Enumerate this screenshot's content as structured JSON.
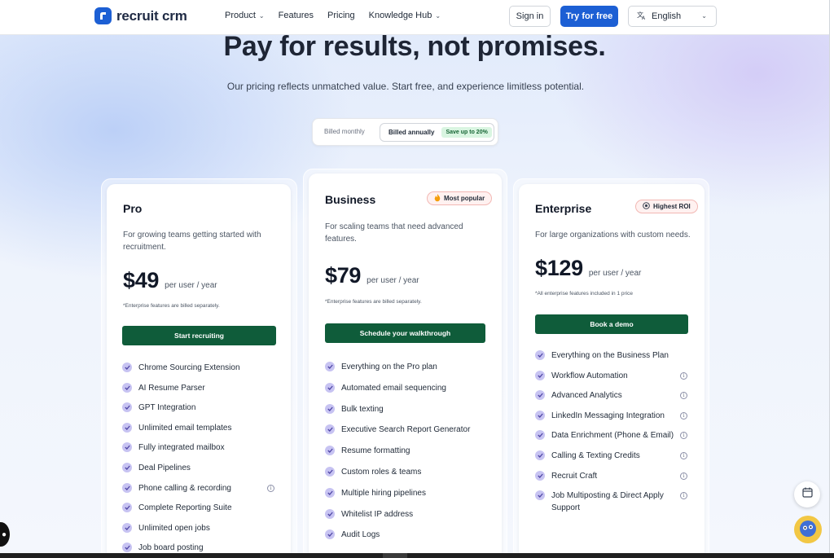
{
  "header": {
    "logo_text": "recruit crm",
    "nav": [
      {
        "label": "Product",
        "has_dropdown": true
      },
      {
        "label": "Features",
        "has_dropdown": false
      },
      {
        "label": "Pricing",
        "has_dropdown": false
      },
      {
        "label": "Knowledge Hub",
        "has_dropdown": true
      }
    ],
    "sign_in": "Sign in",
    "try_free": "Try for free",
    "language": "English"
  },
  "hero": {
    "title": "Pay for results, not promises.",
    "subtitle": "Our pricing reflects unmatched value. Start free, and experience limitless potential."
  },
  "billing": {
    "monthly": "Billed monthly",
    "annually": "Billed annually",
    "save": "Save up to 20%",
    "selected": "annually"
  },
  "plans": [
    {
      "name": "Pro",
      "description": "For growing teams getting started with recruitment.",
      "price": "$49",
      "per": "per user / year",
      "note": "*Enterprise features are billed separately.",
      "cta": "Start recruiting",
      "features": [
        {
          "label": "Chrome Sourcing Extension",
          "info": false
        },
        {
          "label": "AI Resume Parser",
          "info": false
        },
        {
          "label": "GPT Integration",
          "info": false
        },
        {
          "label": "Unlimited email templates",
          "info": false
        },
        {
          "label": "Fully integrated mailbox",
          "info": false
        },
        {
          "label": "Deal Pipelines",
          "info": false
        },
        {
          "label": "Phone calling & recording",
          "info": true
        },
        {
          "label": "Complete Reporting Suite",
          "info": false
        },
        {
          "label": "Unlimited open jobs",
          "info": false
        },
        {
          "label": "Job board posting",
          "info": false
        }
      ]
    },
    {
      "name": "Business",
      "badge": "Most popular",
      "description": "For scaling teams that need advanced features.",
      "price": "$79",
      "per": "per user / year",
      "note": "*Enterprise features are billed separately.",
      "cta": "Schedule your walkthrough",
      "features": [
        {
          "label": "Everything on the Pro plan",
          "info": false
        },
        {
          "label": "Automated email sequencing",
          "info": false
        },
        {
          "label": "Bulk texting",
          "info": false
        },
        {
          "label": "Executive Search Report Generator",
          "info": false
        },
        {
          "label": "Resume formatting",
          "info": false
        },
        {
          "label": "Custom roles & teams",
          "info": false
        },
        {
          "label": "Multiple hiring pipelines",
          "info": false
        },
        {
          "label": "Whitelist IP address",
          "info": false
        },
        {
          "label": "Audit Logs",
          "info": false
        }
      ]
    },
    {
      "name": "Enterprise",
      "badge": "Highest ROI",
      "description": "For large organizations with custom needs.",
      "price": "$129",
      "per": "per user / year",
      "note": "*All enterprise features included in 1 price",
      "cta": "Book a demo",
      "features": [
        {
          "label": "Everything on the Business Plan",
          "info": false
        },
        {
          "label": "Workflow Automation",
          "info": true
        },
        {
          "label": "Advanced Analytics",
          "info": true
        },
        {
          "label": "LinkedIn Messaging Integration",
          "info": true
        },
        {
          "label": "Data Enrichment (Phone & Email)",
          "info": true
        },
        {
          "label": "Calling & Texting Credits",
          "info": true
        },
        {
          "label": "Recruit Craft",
          "info": true
        },
        {
          "label": "Job Multiposting & Direct Apply Support",
          "info": true
        }
      ]
    }
  ],
  "colors": {
    "brand_blue": "#1c5fd4",
    "cta_green": "#0f5c3a",
    "check_purple": "#c7c3f2"
  },
  "icons": {
    "calendar": "calendar-icon",
    "assistant": "chatbot-icon",
    "language": "translate-icon"
  }
}
